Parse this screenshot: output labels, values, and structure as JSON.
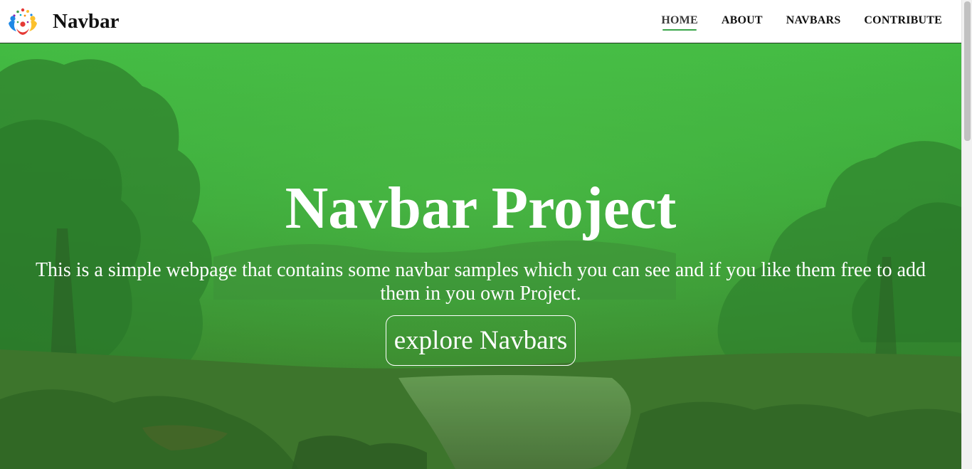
{
  "brand": {
    "name": "Navbar",
    "logo_icon": "colorful-people-circle-logo"
  },
  "nav": {
    "items": [
      {
        "label": "HOME",
        "active": true
      },
      {
        "label": "ABOUT",
        "active": false
      },
      {
        "label": "NAVBARS",
        "active": false
      },
      {
        "label": "CONTRIBUTE",
        "active": false
      }
    ],
    "active_underline_color": "#3aa64a"
  },
  "hero": {
    "title": "Navbar Project",
    "text": "This is a simple webpage that contains some navbar samples which you can see and if you like them free to add them in you own Project.",
    "button_label": "explore Navbars",
    "overlay_color": "#3cc03c"
  }
}
